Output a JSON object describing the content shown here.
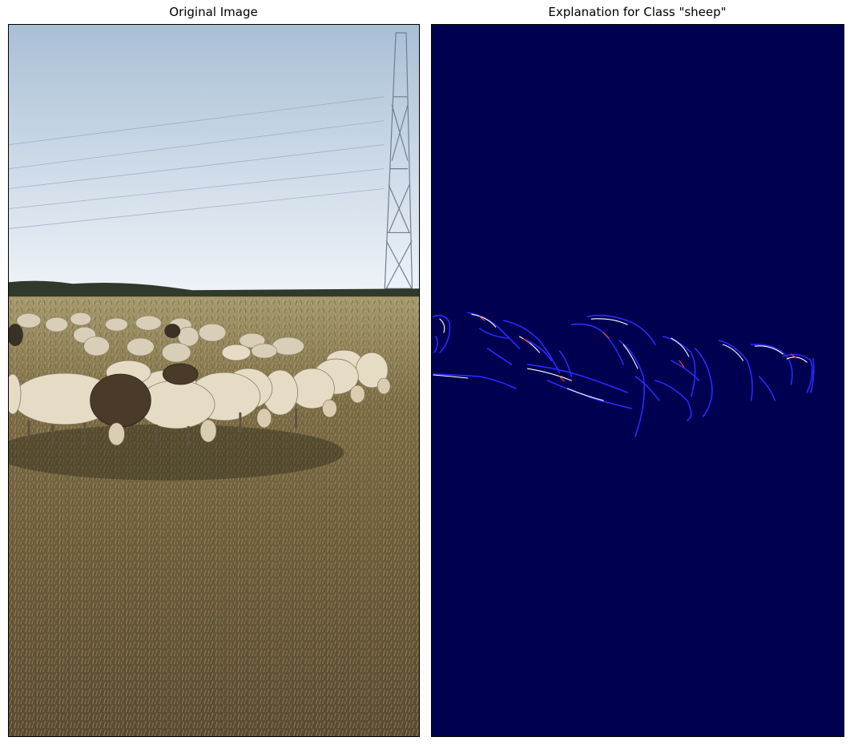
{
  "panels": {
    "left_title": "Original Image",
    "right_title": "Explanation for Class \"sheep\""
  },
  "colors": {
    "sky_top": "#9fb6cc",
    "sky_bottom": "#e6eef6",
    "treeline": "#2f3a2a",
    "field": "#8a7a55",
    "grass_dark": "#4f4a2e",
    "sheep_fill": "#e6dcc5",
    "heatmap_bg": "#000050",
    "heatmap_edge_blue": "#2a2aff",
    "heatmap_edge_white": "#ffffff",
    "heatmap_edge_red": "#ff4020"
  }
}
